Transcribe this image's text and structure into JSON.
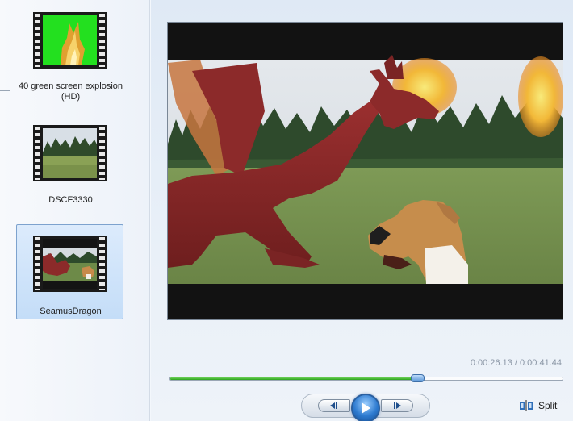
{
  "storyboard": {
    "clips": [
      {
        "label": "40 green screen explosion (HD)",
        "selected": false
      },
      {
        "label": "DSCF3330",
        "selected": false
      },
      {
        "label": "SeamusDragon",
        "selected": true
      }
    ]
  },
  "preview": {
    "current_time": "0:00:26.13",
    "total_time": "0:00:41.44",
    "time_readout": "0:00:26.13 / 0:00:41.44",
    "progress_fraction": 0.63
  },
  "toolbar": {
    "split_label": "Split"
  },
  "icons": {
    "prev": "previous-frame-icon",
    "play": "play-icon",
    "next": "next-frame-icon",
    "split": "split-icon"
  },
  "colors": {
    "seek_fill": "#2aa31c",
    "selection": "#c4ddf8",
    "play_button": "#2e7bd0"
  }
}
